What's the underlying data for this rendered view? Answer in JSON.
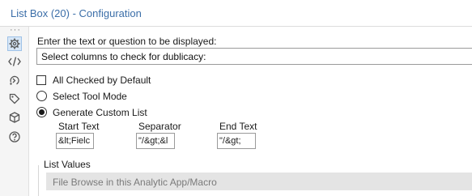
{
  "window": {
    "title": "List Box (20) - Configuration"
  },
  "toolbar": {
    "overflow": "···",
    "icons": [
      "gear-icon",
      "code-icon",
      "connection-icon",
      "tag-icon",
      "cube-icon",
      "help-icon"
    ]
  },
  "form": {
    "prompt_label": "Enter the text or question to be displayed:",
    "prompt_value": "Select columns to check for dublicacy:",
    "all_checked_label": "All Checked by Default",
    "all_checked": false,
    "mode_select_label": "Select Tool Mode",
    "mode_custom_label": "Generate Custom List",
    "selected_mode": "Generate Custom List",
    "start_text_label": "Start Text",
    "start_text_value": "&lt;Fielc",
    "separator_label": "Separator",
    "separator_value": "\"/&gt;&l",
    "end_text_label": "End Text",
    "end_text_value": "\"/&gt;",
    "list_values_label": "List Values",
    "list_values_value": "File Browse in this Analytic App/Macro"
  },
  "colors": {
    "title_text": "#3b6ea8",
    "active_icon_bg": "#d7e6f6",
    "disabled_dropdown_bg": "#e4e4e4"
  }
}
